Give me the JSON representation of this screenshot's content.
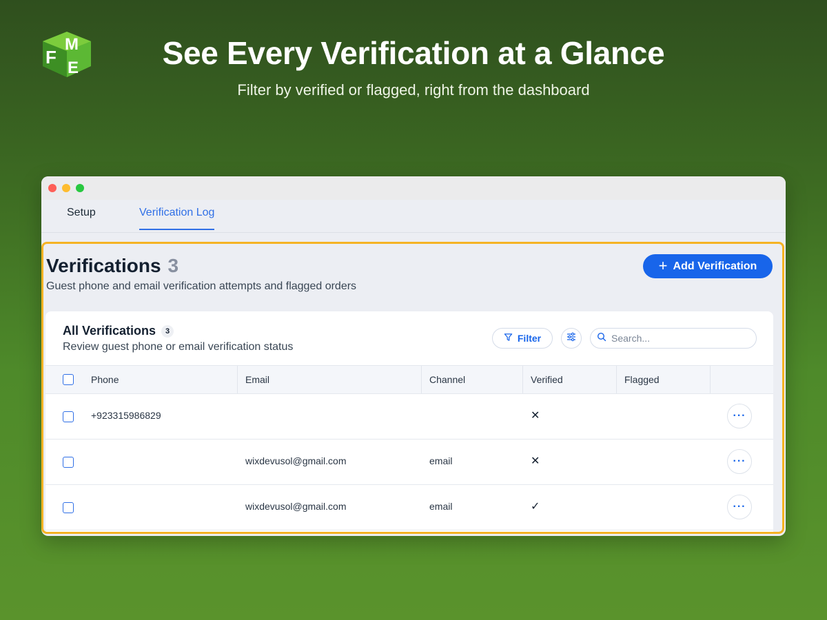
{
  "hero": {
    "title": "See Every Verification at a Glance",
    "subtitle": "Filter by verified or flagged, right from the dashboard"
  },
  "colors": {
    "accent": "#1865ea",
    "highlight": "#f5b324",
    "background_top": "#2f4f1e",
    "background_bottom": "#5a932c"
  },
  "tabs": [
    {
      "label": "Setup",
      "active": false
    },
    {
      "label": "Verification Log",
      "active": true
    }
  ],
  "page": {
    "title": "Verifications",
    "count": "3",
    "description": "Guest phone and email verification attempts and flagged orders",
    "add_button_label": "Add Verification"
  },
  "card": {
    "title": "All Verifications",
    "badge": "3",
    "description": "Review guest phone or email verification status",
    "filter_label": "Filter",
    "search_placeholder": "Search..."
  },
  "table": {
    "columns": [
      "Phone",
      "Email",
      "Channel",
      "Verified",
      "Flagged"
    ],
    "rows": [
      {
        "phone": "+923315986829",
        "email": "",
        "channel": "",
        "verified": "✕",
        "flagged": ""
      },
      {
        "phone": "",
        "email": "wixdevusol@gmail.com",
        "channel": "email",
        "verified": "✕",
        "flagged": ""
      },
      {
        "phone": "",
        "email": "wixdevusol@gmail.com",
        "channel": "email",
        "verified": "✓",
        "flagged": ""
      }
    ],
    "row_action_label": "···"
  }
}
